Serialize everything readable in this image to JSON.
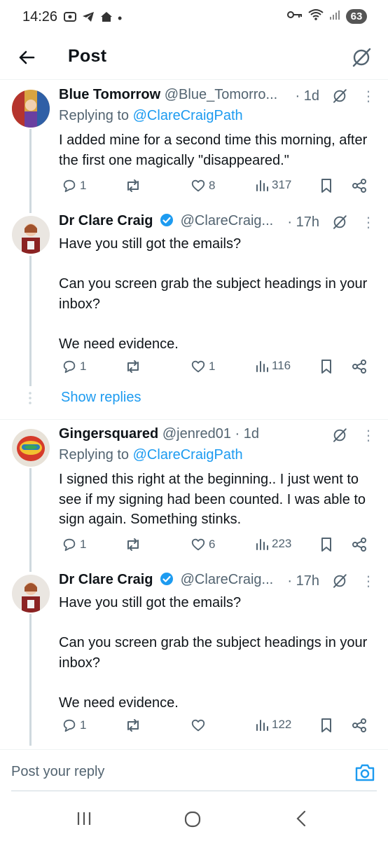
{
  "status_bar": {
    "time": "14:26",
    "battery": "63"
  },
  "header": {
    "title": "Post"
  },
  "tweets": [
    {
      "author": "Blue Tomorrow",
      "handle": "@Blue_Tomorro...",
      "time": "· 1d",
      "verified": false,
      "replying_prefix": "Replying to ",
      "replying_to": "@ClareCraigPath",
      "lines": [
        "I added mine for a second time this morning, after the first one magically \"disappeared.\""
      ],
      "replies": "1",
      "retweets": "",
      "likes": "8",
      "views": "317"
    },
    {
      "author": "Dr Clare Craig",
      "handle": "@ClareCraig...",
      "time": "· 17h",
      "verified": true,
      "lines": [
        "Have you still got the emails?",
        "",
        "Can you screen grab the subject headings in your inbox?",
        "",
        "We need evidence."
      ],
      "replies": "1",
      "retweets": "",
      "likes": "1",
      "views": "116"
    },
    {
      "author": "Gingersquared",
      "handle": "@jenred01",
      "time": "· 1d",
      "verified": false,
      "replying_prefix": "Replying to ",
      "replying_to": "@ClareCraigPath",
      "lines": [
        "I signed this right at the beginning.. I just went to see if my signing had been counted. I was able to sign again.  Something stinks."
      ],
      "replies": "1",
      "retweets": "",
      "likes": "6",
      "views": "223"
    },
    {
      "author": "Dr Clare Craig",
      "handle": "@ClareCraig...",
      "time": "· 17h",
      "verified": true,
      "lines": [
        "Have you still got the emails?",
        "",
        "Can you screen grab the subject headings in your inbox?",
        "",
        "We need evidence."
      ],
      "replies": "1",
      "retweets": "",
      "likes": "",
      "views": "122"
    }
  ],
  "show_replies": "Show replies",
  "reply_bar": {
    "placeholder": "Post your reply"
  },
  "colors": {
    "accent": "#1d9bf0",
    "text": "#0f1419",
    "muted": "#536471",
    "thread_line": "#cfd9de"
  },
  "icons": {
    "back": "arrow-left-icon",
    "grok": "grok-icon",
    "reply": "speech-bubble-icon",
    "retweet": "retweet-icon",
    "like": "heart-icon",
    "views": "bar-chart-icon",
    "bookmark": "bookmark-icon",
    "share": "share-icon",
    "camera": "camera-icon"
  }
}
